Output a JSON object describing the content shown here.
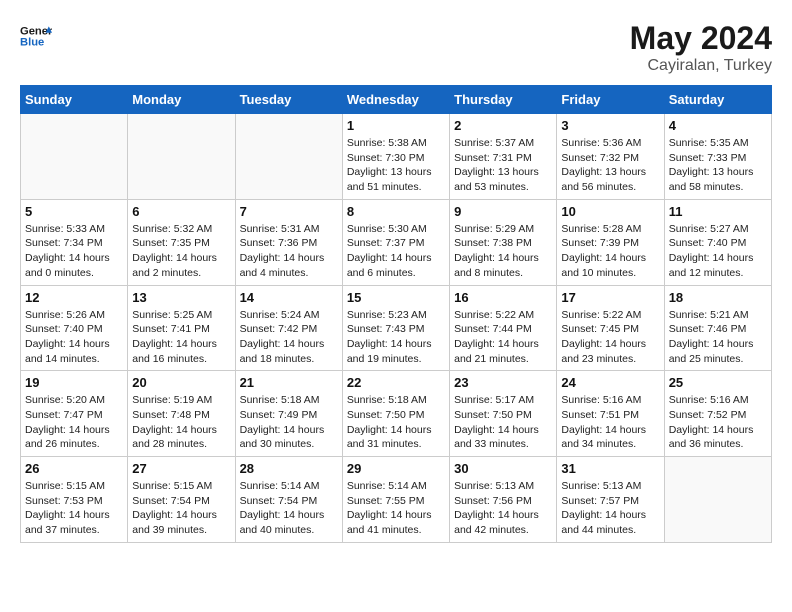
{
  "header": {
    "logo_general": "General",
    "logo_blue": "Blue",
    "month_year": "May 2024",
    "location": "Cayiralan, Turkey"
  },
  "weekdays": [
    "Sunday",
    "Monday",
    "Tuesday",
    "Wednesday",
    "Thursday",
    "Friday",
    "Saturday"
  ],
  "weeks": [
    [
      {
        "day": "",
        "sunrise": "",
        "sunset": "",
        "daylight": ""
      },
      {
        "day": "",
        "sunrise": "",
        "sunset": "",
        "daylight": ""
      },
      {
        "day": "",
        "sunrise": "",
        "sunset": "",
        "daylight": ""
      },
      {
        "day": "1",
        "sunrise": "Sunrise: 5:38 AM",
        "sunset": "Sunset: 7:30 PM",
        "daylight": "Daylight: 13 hours and 51 minutes."
      },
      {
        "day": "2",
        "sunrise": "Sunrise: 5:37 AM",
        "sunset": "Sunset: 7:31 PM",
        "daylight": "Daylight: 13 hours and 53 minutes."
      },
      {
        "day": "3",
        "sunrise": "Sunrise: 5:36 AM",
        "sunset": "Sunset: 7:32 PM",
        "daylight": "Daylight: 13 hours and 56 minutes."
      },
      {
        "day": "4",
        "sunrise": "Sunrise: 5:35 AM",
        "sunset": "Sunset: 7:33 PM",
        "daylight": "Daylight: 13 hours and 58 minutes."
      }
    ],
    [
      {
        "day": "5",
        "sunrise": "Sunrise: 5:33 AM",
        "sunset": "Sunset: 7:34 PM",
        "daylight": "Daylight: 14 hours and 0 minutes."
      },
      {
        "day": "6",
        "sunrise": "Sunrise: 5:32 AM",
        "sunset": "Sunset: 7:35 PM",
        "daylight": "Daylight: 14 hours and 2 minutes."
      },
      {
        "day": "7",
        "sunrise": "Sunrise: 5:31 AM",
        "sunset": "Sunset: 7:36 PM",
        "daylight": "Daylight: 14 hours and 4 minutes."
      },
      {
        "day": "8",
        "sunrise": "Sunrise: 5:30 AM",
        "sunset": "Sunset: 7:37 PM",
        "daylight": "Daylight: 14 hours and 6 minutes."
      },
      {
        "day": "9",
        "sunrise": "Sunrise: 5:29 AM",
        "sunset": "Sunset: 7:38 PM",
        "daylight": "Daylight: 14 hours and 8 minutes."
      },
      {
        "day": "10",
        "sunrise": "Sunrise: 5:28 AM",
        "sunset": "Sunset: 7:39 PM",
        "daylight": "Daylight: 14 hours and 10 minutes."
      },
      {
        "day": "11",
        "sunrise": "Sunrise: 5:27 AM",
        "sunset": "Sunset: 7:40 PM",
        "daylight": "Daylight: 14 hours and 12 minutes."
      }
    ],
    [
      {
        "day": "12",
        "sunrise": "Sunrise: 5:26 AM",
        "sunset": "Sunset: 7:40 PM",
        "daylight": "Daylight: 14 hours and 14 minutes."
      },
      {
        "day": "13",
        "sunrise": "Sunrise: 5:25 AM",
        "sunset": "Sunset: 7:41 PM",
        "daylight": "Daylight: 14 hours and 16 minutes."
      },
      {
        "day": "14",
        "sunrise": "Sunrise: 5:24 AM",
        "sunset": "Sunset: 7:42 PM",
        "daylight": "Daylight: 14 hours and 18 minutes."
      },
      {
        "day": "15",
        "sunrise": "Sunrise: 5:23 AM",
        "sunset": "Sunset: 7:43 PM",
        "daylight": "Daylight: 14 hours and 19 minutes."
      },
      {
        "day": "16",
        "sunrise": "Sunrise: 5:22 AM",
        "sunset": "Sunset: 7:44 PM",
        "daylight": "Daylight: 14 hours and 21 minutes."
      },
      {
        "day": "17",
        "sunrise": "Sunrise: 5:22 AM",
        "sunset": "Sunset: 7:45 PM",
        "daylight": "Daylight: 14 hours and 23 minutes."
      },
      {
        "day": "18",
        "sunrise": "Sunrise: 5:21 AM",
        "sunset": "Sunset: 7:46 PM",
        "daylight": "Daylight: 14 hours and 25 minutes."
      }
    ],
    [
      {
        "day": "19",
        "sunrise": "Sunrise: 5:20 AM",
        "sunset": "Sunset: 7:47 PM",
        "daylight": "Daylight: 14 hours and 26 minutes."
      },
      {
        "day": "20",
        "sunrise": "Sunrise: 5:19 AM",
        "sunset": "Sunset: 7:48 PM",
        "daylight": "Daylight: 14 hours and 28 minutes."
      },
      {
        "day": "21",
        "sunrise": "Sunrise: 5:18 AM",
        "sunset": "Sunset: 7:49 PM",
        "daylight": "Daylight: 14 hours and 30 minutes."
      },
      {
        "day": "22",
        "sunrise": "Sunrise: 5:18 AM",
        "sunset": "Sunset: 7:50 PM",
        "daylight": "Daylight: 14 hours and 31 minutes."
      },
      {
        "day": "23",
        "sunrise": "Sunrise: 5:17 AM",
        "sunset": "Sunset: 7:50 PM",
        "daylight": "Daylight: 14 hours and 33 minutes."
      },
      {
        "day": "24",
        "sunrise": "Sunrise: 5:16 AM",
        "sunset": "Sunset: 7:51 PM",
        "daylight": "Daylight: 14 hours and 34 minutes."
      },
      {
        "day": "25",
        "sunrise": "Sunrise: 5:16 AM",
        "sunset": "Sunset: 7:52 PM",
        "daylight": "Daylight: 14 hours and 36 minutes."
      }
    ],
    [
      {
        "day": "26",
        "sunrise": "Sunrise: 5:15 AM",
        "sunset": "Sunset: 7:53 PM",
        "daylight": "Daylight: 14 hours and 37 minutes."
      },
      {
        "day": "27",
        "sunrise": "Sunrise: 5:15 AM",
        "sunset": "Sunset: 7:54 PM",
        "daylight": "Daylight: 14 hours and 39 minutes."
      },
      {
        "day": "28",
        "sunrise": "Sunrise: 5:14 AM",
        "sunset": "Sunset: 7:54 PM",
        "daylight": "Daylight: 14 hours and 40 minutes."
      },
      {
        "day": "29",
        "sunrise": "Sunrise: 5:14 AM",
        "sunset": "Sunset: 7:55 PM",
        "daylight": "Daylight: 14 hours and 41 minutes."
      },
      {
        "day": "30",
        "sunrise": "Sunrise: 5:13 AM",
        "sunset": "Sunset: 7:56 PM",
        "daylight": "Daylight: 14 hours and 42 minutes."
      },
      {
        "day": "31",
        "sunrise": "Sunrise: 5:13 AM",
        "sunset": "Sunset: 7:57 PM",
        "daylight": "Daylight: 14 hours and 44 minutes."
      },
      {
        "day": "",
        "sunrise": "",
        "sunset": "",
        "daylight": ""
      }
    ]
  ]
}
